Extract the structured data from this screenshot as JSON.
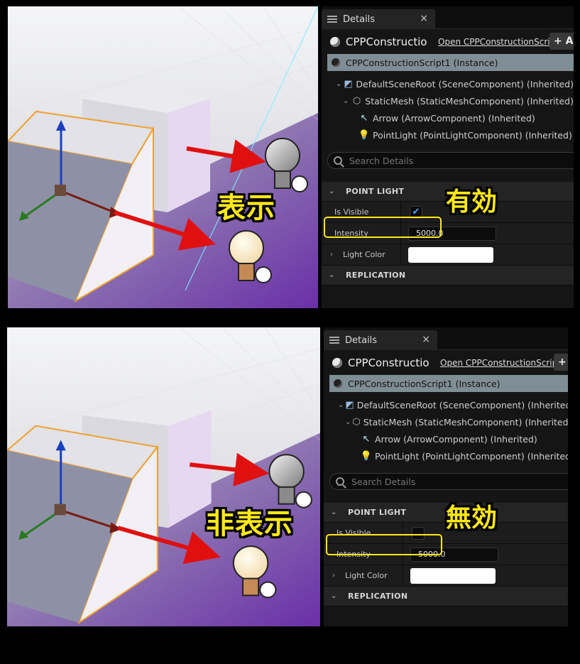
{
  "top": {
    "viewport_label": "表示",
    "status_label": "有効",
    "tab": {
      "label": "Details",
      "close": "×"
    },
    "actor": {
      "name": "CPPConstructio",
      "open_link": "Open CPPConstructionScript",
      "add_label": "+ A"
    },
    "instance": {
      "label": "CPPConstructionScript1 (Instance)"
    },
    "tree": [
      {
        "label": "DefaultSceneRoot (SceneComponent) (Inherited)",
        "icon": "scene-component-icon"
      },
      {
        "label": "StaticMesh (StaticMeshComponent) (Inherited)",
        "icon": "static-mesh-icon"
      },
      {
        "label": "Arrow (ArrowComponent) (Inherited)",
        "icon": "arrow-component-icon"
      },
      {
        "label": "PointLight (PointLightComponent) (Inherited)",
        "icon": "point-light-icon"
      }
    ],
    "search": {
      "placeholder": "Search Details"
    },
    "sections": {
      "point_light": "POINT LIGHT",
      "replication": "REPLICATION"
    },
    "props": {
      "is_visible_label": "Is Visible",
      "is_visible_checked": "✔",
      "intensity_label": "Intensity",
      "intensity_value": "5000.0",
      "light_color_label": "Light Color",
      "light_color_value": "#ffffff"
    }
  },
  "bottom": {
    "viewport_label": "非表示",
    "status_label": "無効",
    "tab": {
      "label": "Details",
      "close": "×"
    },
    "actor": {
      "name": "CPPConstructio",
      "open_link": "Open CPPConstructionScript",
      "add_label": "+"
    },
    "instance": {
      "label": "CPPConstructionScript1 (Instance)"
    },
    "tree": [
      {
        "label": "DefaultSceneRoot (SceneComponent) (Inherited)",
        "icon": "scene-component-icon"
      },
      {
        "label": "StaticMesh (StaticMeshComponent) (Inherited)",
        "icon": "static-mesh-icon"
      },
      {
        "label": "Arrow (ArrowComponent) (Inherited)",
        "icon": "arrow-component-icon"
      },
      {
        "label": "PointLight (PointLightComponent) (Inherited)",
        "icon": "point-light-icon"
      }
    ],
    "search": {
      "placeholder": "Search Details"
    },
    "sections": {
      "point_light": "POINT LIGHT",
      "replication": "REPLICATION"
    },
    "props": {
      "is_visible_label": "Is Visible",
      "is_visible_checked": "",
      "intensity_label": "Intensity",
      "intensity_value": "5000.0",
      "light_color_label": "Light Color",
      "light_color_value": "#ffffff"
    }
  },
  "colors": {
    "accent_yellow": "#ffe817",
    "selection": "#7f8e94",
    "arrow_red": "#e01010"
  }
}
